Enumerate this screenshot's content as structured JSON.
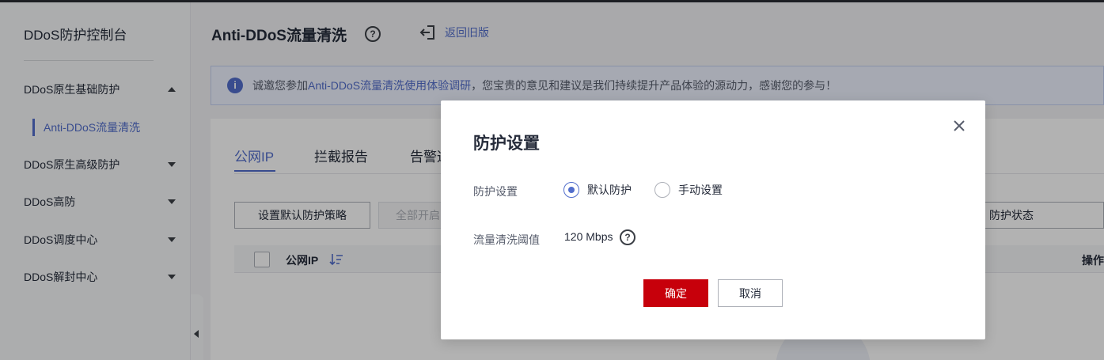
{
  "sidebar": {
    "title": "DDoS防护控制台",
    "items": [
      {
        "label": "DDoS原生基础防护",
        "expanded": true
      },
      {
        "label": "DDoS原生高级防护",
        "expanded": false
      },
      {
        "label": "DDoS高防",
        "expanded": false
      },
      {
        "label": "DDoS调度中心",
        "expanded": false
      },
      {
        "label": "DDoS解封中心",
        "expanded": false
      }
    ],
    "active_subitem": "Anti-DDoS流量清洗"
  },
  "header": {
    "title": "Anti-DDoS流量清洗",
    "help_icon": "question-circle-icon",
    "back_icon": "exit-icon",
    "back_label": "返回旧版"
  },
  "notice": {
    "prefix": "诚邀您参加",
    "link": "Anti-DDoS流量清洗使用体验调研",
    "suffix": "，您宝贵的意见和建议是我们持续提升产品体验的源动力，感谢您的参与！"
  },
  "tabs": [
    "公网IP",
    "拦截报告",
    "告警通"
  ],
  "toolbar": {
    "set_default_policy": "设置默认防护策略",
    "enable_all": "全部开启",
    "protection_status_filter": "防护状态"
  },
  "table": {
    "col_public_ip": "公网IP",
    "col_actions": "操作"
  },
  "dialog": {
    "title": "防护设置",
    "protection_label": "防护设置",
    "option_default": "默认防护",
    "option_manual": "手动设置",
    "selected_option": "默认防护",
    "threshold_label": "流量清洗阈值",
    "threshold_value": "120 Mbps",
    "confirm": "确定",
    "cancel": "取消"
  },
  "colors": {
    "accent": "#526ecc",
    "primary_button": "#c7000b"
  }
}
